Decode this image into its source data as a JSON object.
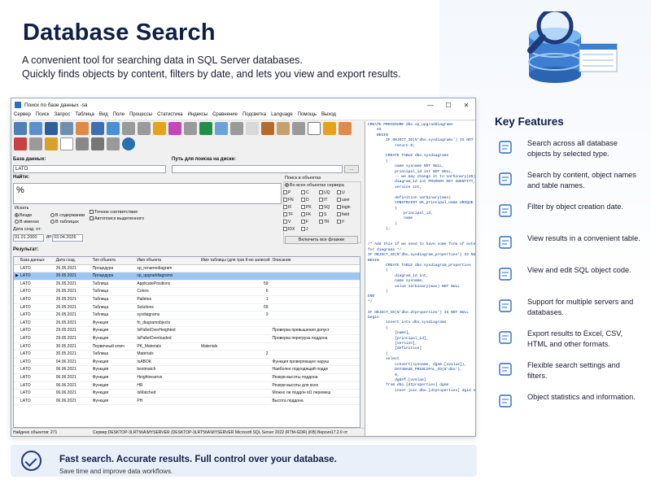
{
  "title": "Database Search",
  "subtitle_lines": [
    "A convenient tool for searching data in SQL Server databases.",
    "Quickly finds objects by content, filters by date, and lets you view and export results."
  ],
  "window": {
    "title": "Поиск по базе данных -sa",
    "controls": [
      "—",
      "☐",
      "✕"
    ]
  },
  "menu": [
    "Сервер",
    "Поиск",
    "Запрос",
    "Таблица",
    "Вид",
    "Поле",
    "Процессы",
    "Статистика",
    "Индексы",
    "Сравнение",
    "Подсветка",
    "Language",
    "Помощь",
    "Выход"
  ],
  "form": {
    "db_label": "База данных:",
    "db_value": "LATO",
    "path_label": "Путь для поиска на диске:",
    "browse": "...",
    "find_label": "Найти:",
    "find_value": "%",
    "search_in": "Искать",
    "scope_opts": [
      "Везде",
      "В именах",
      "В содержании",
      "В таблицах"
    ],
    "checks": [
      "Точное соответствие",
      "Автопоиск выделенного"
    ],
    "date_label": "Дата созд. от:",
    "date_from": "01.01.2000",
    "date_to_label": "до",
    "date_to": "03.04.2026",
    "obj_group": "Поиск в объектах",
    "all_objects": "Во всех объектах сервера",
    "obj_types": [
      "P",
      "C",
      "UQ",
      "U",
      "FN",
      "D",
      "IT",
      "user",
      "IF",
      "PK",
      "SQ",
      "login",
      "TF",
      "FK",
      "S",
      "field",
      "V",
      "F",
      "TR",
      "#",
      "IDX",
      "J"
    ],
    "enable_all": "Включить все флажки",
    "results_label": "Результат:"
  },
  "grid": {
    "headers": [
      "База данных",
      "Дата созд.",
      "Тип объекта",
      "Имя объекта",
      "Имя таблицы (для тригг)",
      "К-во записей",
      "Описание"
    ],
    "rows": [
      [
        "LATO",
        "26.05.2021",
        "Процедура",
        "sp_renamediagram",
        "",
        "",
        ""
      ],
      [
        "LATO",
        "26.05.2021",
        "Процедура",
        "sp_upgraddiagrams",
        "",
        "",
        ""
      ],
      [
        "LATO",
        "26.05.2021",
        "Таблица",
        "ApplicatePositions",
        "",
        "59",
        ""
      ],
      [
        "LATO",
        "26.05.2021",
        "Таблица",
        "Colors",
        "",
        "6",
        ""
      ],
      [
        "LATO",
        "26.05.2021",
        "Таблица",
        "Palletes",
        "",
        "1",
        ""
      ],
      [
        "LATO",
        "26.05.2021",
        "Таблица",
        "Solutions",
        "",
        "59",
        ""
      ],
      [
        "LATO",
        "26.05.2021",
        "Таблица",
        "sysdiagrams",
        "",
        "3",
        ""
      ],
      [
        "LATO",
        "26.05.2021",
        "Функция",
        "fn_diagramobjects",
        "",
        "",
        ""
      ],
      [
        "LATO",
        "29.05.2021",
        "Функция",
        "IsPalletOverHeighted",
        "",
        "",
        "Проверка превышения допуст"
      ],
      [
        "LATO",
        "29.05.2021",
        "Функция",
        "IsPalletOverloaded",
        "",
        "",
        "Проверка перегруза поддона"
      ],
      [
        "LATO",
        "30.05.2021",
        "Первичный ключ",
        "PK_Materials",
        "Materials",
        "",
        ""
      ],
      [
        "LATO",
        "30.05.2021",
        "Таблица",
        "Materials",
        "",
        "2",
        ""
      ],
      [
        "LATO",
        "04.06.2021",
        "Функция",
        "IsABOK",
        "",
        "",
        "Функция проверяющее наруш"
      ],
      [
        "LATO",
        "06.06.2021",
        "Функция",
        "bestmatch",
        "",
        "",
        "Наиболее подходящий подде"
      ],
      [
        "LATO",
        "06.06.2021",
        "Функция",
        "Heightreserve",
        "",
        "",
        "Резерв высоты поддона"
      ],
      [
        "LATO",
        "06.06.2021",
        "Функция",
        "HR",
        "",
        "",
        "Резерв высоты для всех"
      ],
      [
        "LATO",
        "06.06.2021",
        "Функция",
        "IsMatched",
        "",
        "",
        "Можно ли поддон id1 перемеш"
      ],
      [
        "LATO",
        "06.06.2021",
        "Функция",
        "PH",
        "",
        "",
        "Высота поддона"
      ]
    ],
    "selected_index": 1
  },
  "status": {
    "found": "Найдено объектов: 271",
    "server": "Сервер:DESKTOP-3LRT56A\\MYSERVER (DESKTOP-3LRT56A\\MYSERVER Microsoft SQL Server 2022 (RTM-GDR) (KB) Версия17.2.0 от"
  },
  "code_lines": [
    "CREATE PROCEDURE dbo.sp_upgraddiagrams",
    "    AS",
    "    BEGIN",
    "        IF OBJECT_ID(N'dbo.sysdiagrams') IS NOT NULL",
    "            return 0;",
    "",
    "        CREATE TABLE dbo.sysdiagrams",
    "        (",
    "            name sysname NOT NULL,",
    "            principal_id int NOT NULL,",
    "            -- we may change it to varbinary(85)",
    "            diagram_id int PRIMARY KEY IDENTITY,",
    "            version int,",
    "",
    "            definition varbinary(max)",
    "            CONSTRAINT UK_principal_name UNIQUE",
    "            (",
    "                principal_id,",
    "                name",
    "            )",
    "        );",
    "",
    "",
    "/* Add this if we need to have some form of extended prop",
    "for diagrams */",
    "IF OBJECT_ID(N'dbo.sysdiagram_properties') IS NULL",
    "BEGIN",
    "        CREATE TABLE dbo.sysdiagram_properties",
    "        (",
    "            diagram_id int,",
    "            name sysname,",
    "            value varbinary(max) NOT NULL",
    "        )",
    "END",
    "*/",
    "",
    "IF OBJECT_ID(N'dbo.dtproperties') IS NOT NULL",
    "begin",
    "        insert into dbo.sysdiagrams",
    "        (",
    "            [name],",
    "            [principal_id],",
    "            [version],",
    "            [definition]",
    "        )",
    "        select",
    "            convert(sysname, dgnm.[uvalue]),",
    "            DATABASE_PRINCIPAL_ID(N'dbo'),",
    "            0,",
    "            dgdef.[uvalue]",
    "        from dbo.[dtproperties] dgnm",
    "            inner join dbo.[dtproperties] dgid on dgid.[property] = 'Dtgs"
  ],
  "banner": {
    "headline": "Fast search. Accurate results. Full control over your database.",
    "tagline": "Save time and improve data workflows."
  },
  "key_features": {
    "heading": "Key Features",
    "items": [
      {
        "icon": "search-icon",
        "text": "Search across all database objects by selected type."
      },
      {
        "icon": "document-search-icon",
        "text": "Search by content, object names and table names."
      },
      {
        "icon": "calendar-icon",
        "text": "Filter by object creation date."
      },
      {
        "icon": "table-icon",
        "text": "View results in a convenient table."
      },
      {
        "icon": "code-icon",
        "text": "View and edit SQL object code."
      },
      {
        "icon": "servers-icon",
        "text": "Support for multiple servers and databases."
      },
      {
        "icon": "export-icon",
        "text": "Export results to Excel, CSV, HTML and other formats."
      },
      {
        "icon": "settings-icon",
        "text": "Flexible search settings and filters."
      },
      {
        "icon": "stats-icon",
        "text": "Object statistics and information."
      }
    ]
  },
  "colors": {
    "accent": "#1e3a7a",
    "brand": "#0f1f45",
    "selection": "#9cc7f1"
  }
}
